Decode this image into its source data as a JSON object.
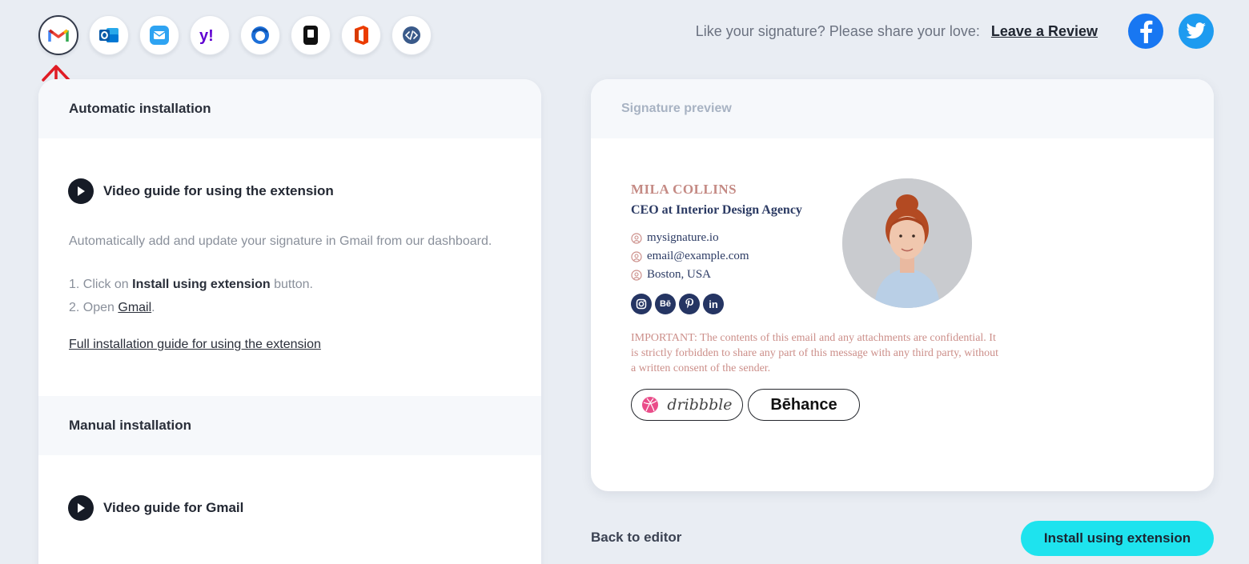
{
  "toolbar": {
    "clients": [
      {
        "name": "gmail-icon",
        "active": true
      },
      {
        "name": "outlook-icon",
        "active": false
      },
      {
        "name": "apple-mail-icon",
        "active": false
      },
      {
        "name": "yahoo-icon",
        "active": false
      },
      {
        "name": "thunderbird-icon",
        "active": false
      },
      {
        "name": "iphone-icon",
        "active": false
      },
      {
        "name": "office365-icon",
        "active": false
      },
      {
        "name": "html-code-icon",
        "active": false
      }
    ],
    "share_text": "Like your signature? Please share your love:",
    "review_label": "Leave a Review",
    "socials": [
      "facebook-icon",
      "twitter-icon"
    ]
  },
  "left": {
    "auto_header": "Automatic installation",
    "video_guide_extension": "Video guide for using the extension",
    "description": "Automatically add and update your signature in Gmail from our dashboard.",
    "step1_prefix": "1.  Click on ",
    "step1_bold": "Install using extension",
    "step1_suffix": " button.",
    "step2_prefix": "2. Open ",
    "step2_link": "Gmail",
    "step2_suffix": ".",
    "full_guide": "Full installation guide for using the extension",
    "manual_header": "Manual installation",
    "video_guide_gmail": "Video guide for Gmail"
  },
  "preview": {
    "header": "Signature preview",
    "name": "MILA COLLINS",
    "title": "CEO at Interior Design Agency",
    "website": "mysignature.io",
    "email": "email@example.com",
    "location": "Boston, USA",
    "social_labels": [
      "instagram-icon",
      "behance-icon",
      "pinterest-icon",
      "linkedin-icon"
    ],
    "behance_short": "Bē",
    "linkedin_short": "in",
    "disclaimer": "IMPORTANT: The contents of this email and any attachments are confidential. It is strictly forbidden to share any part of this message with any third party, without a written consent of the sender.",
    "badge_dribbble": "dribbble",
    "badge_behance": "Bēhance"
  },
  "footer": {
    "back": "Back to editor",
    "install": "Install using extension"
  },
  "colors": {
    "accent": "#1ee3ee",
    "name": "#c48a84",
    "title": "#2b3a63",
    "arrow": "#e01b24"
  }
}
